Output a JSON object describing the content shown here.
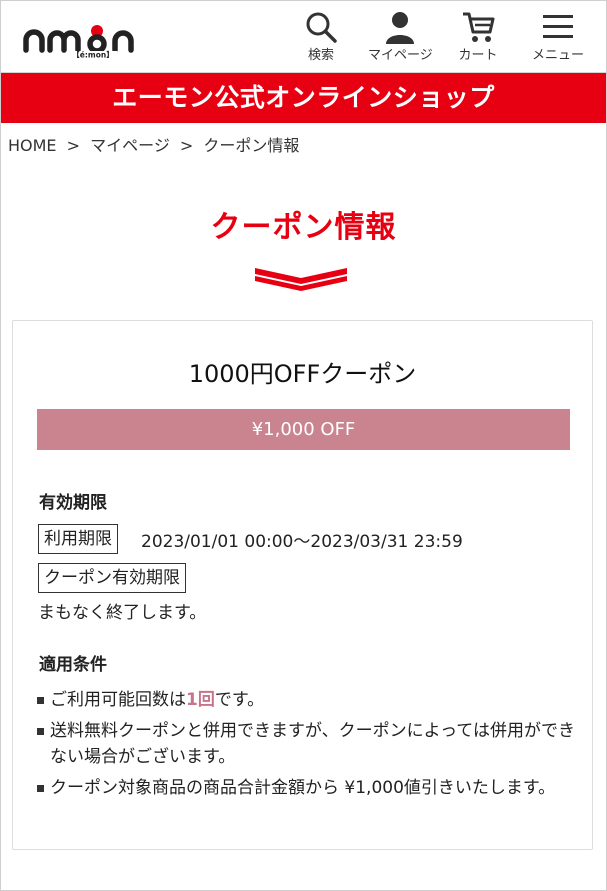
{
  "header": {
    "nav": {
      "search_label": "検索",
      "mypage_label": "マイページ",
      "cart_label": "カート",
      "menu_label": "メニュー"
    }
  },
  "banner": {
    "text": "エーモン公式オンラインショップ"
  },
  "breadcrumb": {
    "items": [
      "HOME",
      "マイページ",
      "クーポン情報"
    ],
    "separator": ">"
  },
  "page": {
    "title": "クーポン情報"
  },
  "coupon": {
    "name": "1000円OFFクーポン",
    "discount": "¥1,000 OFF",
    "validity": {
      "heading": "有効期限",
      "usage_period_label": "利用期限",
      "usage_period_value": "2023/01/01 00:00〜2023/03/31 23:59",
      "coupon_period_label": "クーポン有効期限",
      "coupon_period_value": "まもなく終了します。"
    },
    "conditions": {
      "heading": "適用条件",
      "item1_prefix": "ご利用可能回数は",
      "item1_highlight": "1回",
      "item1_suffix": "です。",
      "item2": "送料無料クーポンと併用できますが、クーポンによっては併用ができない場合がございます。",
      "item3": "クーポン対象商品の商品合計金額から ¥1,000値引きいたします。"
    }
  },
  "colors": {
    "brand_red": "#e60012",
    "discount_bar": "#c9848f",
    "highlight": "#c9748a"
  }
}
